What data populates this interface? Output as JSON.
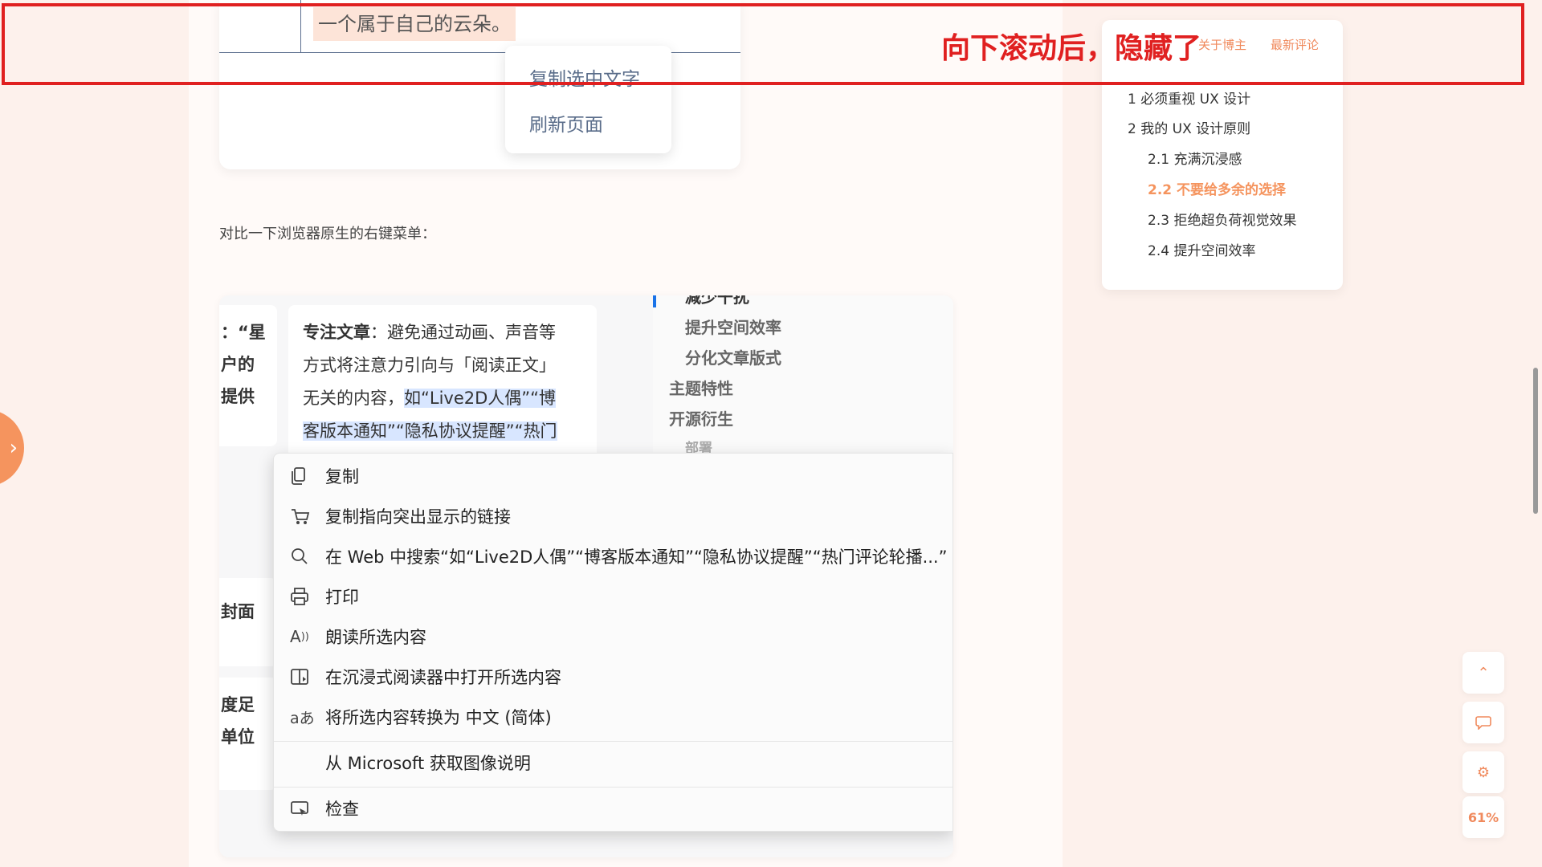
{
  "screenshot_top": {
    "cloud_text": "一个属于自己的云朵。",
    "menu": [
      "复制选中文字",
      "刷新页面"
    ]
  },
  "compare_text": "对比一下浏览器原生的右键菜单：",
  "screenshot_bottom": {
    "left_fragments": [
      "：“星",
      "户的",
      "提供",
      "封面",
      "度足",
      "单位"
    ],
    "para_bold_label": "专注文章",
    "para_line1_rest": "：避免通过动画、声音等",
    "para_line2": "方式将注意力引向与「阅读正文」",
    "para_line3_plain": "无关的内容，",
    "para_line3_hl": "如“Live2D人偶”“博",
    "para_line4_hl": "客版本通知”“隐私协议提醒”“热门",
    "toc_items": [
      "减少干扰",
      "提升空间效率",
      "分化文章版式",
      "主题特性",
      "开源衍生",
      "部署"
    ],
    "context_menu": [
      {
        "icon": "copy-icon",
        "label": "复制"
      },
      {
        "icon": "link-icon",
        "label": "复制指向突出显示的链接"
      },
      {
        "icon": "search-icon",
        "label": "在 Web 中搜索“如“Live2D人偶”“博客版本通知”“隐私协议提醒”“热门评论轮播...”"
      },
      {
        "icon": "print-icon",
        "label": "打印"
      },
      {
        "icon": "read-aloud-icon",
        "label": "朗读所选内容"
      },
      {
        "icon": "immersive-reader-icon",
        "label": "在沉浸式阅读器中打开所选内容"
      },
      {
        "icon": "translate-icon",
        "label": "将所选内容转换为 中文 (简体)"
      },
      {
        "icon": "",
        "label": "从 Microsoft 获取图像说明"
      },
      {
        "icon": "inspect-icon",
        "label": "检查"
      }
    ]
  },
  "sidebar_toc": {
    "tabs": [
      "关于博主",
      "最新评论"
    ],
    "items": [
      {
        "label": "1 必须重视 UX 设计",
        "level": 1,
        "active": false
      },
      {
        "label": "2 我的 UX 设计原则",
        "level": 1,
        "active": false
      },
      {
        "label": "2.1 充满沉浸感",
        "level": 2,
        "active": false
      },
      {
        "label": "2.2 不要给多余的选择",
        "level": 2,
        "active": true
      },
      {
        "label": "2.3 拒绝超负荷视觉效果",
        "level": 2,
        "active": false
      },
      {
        "label": "2.4 提升空间效率",
        "level": 2,
        "active": false
      }
    ]
  },
  "annotation": "向下滚动后，隐藏了",
  "floating": {
    "up": "⌃",
    "comment": "💬",
    "settings": "⚙",
    "progress": "61%"
  },
  "colors": {
    "accent": "#f5945e",
    "annotation_red": "#e02020",
    "highlight_blue": "#d8e6ff"
  }
}
